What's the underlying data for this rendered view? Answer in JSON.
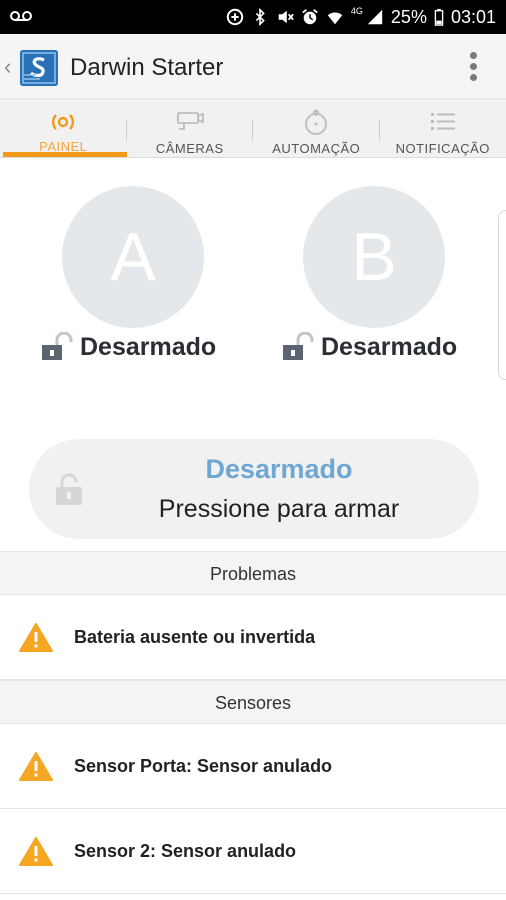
{
  "status_bar": {
    "battery_percent": "25%",
    "time": "03:01",
    "network_tag": "4G",
    "icons": [
      "voicemail-icon",
      "data-saver-icon",
      "bluetooth-icon",
      "mute-icon",
      "alarm-icon",
      "wifi-icon",
      "signal-icon",
      "battery-icon"
    ]
  },
  "app_bar": {
    "title": "Darwin Starter",
    "back_icon": "chevron-left-icon",
    "logo_icon": "darwin-logo-icon",
    "menu_icon": "more-vertical-icon"
  },
  "tabs": [
    {
      "label": "PAINEL",
      "icon": "panel-sensor-icon",
      "active": true
    },
    {
      "label": "CÂMERAS",
      "icon": "camera-icon",
      "active": false
    },
    {
      "label": "AUTOMAÇÃO",
      "icon": "automation-icon",
      "active": false
    },
    {
      "label": "NOTIFICAÇÃO",
      "icon": "list-icon",
      "active": false
    }
  ],
  "partitions": [
    {
      "letter": "A",
      "status": "Desarmado"
    },
    {
      "letter": "B",
      "status": "Desarmado"
    }
  ],
  "arm_button": {
    "status": "Desarmado",
    "hint": "Pressione para armar"
  },
  "problems": {
    "header": "Problemas",
    "items": [
      {
        "text": "Bateria ausente ou invertida"
      }
    ]
  },
  "sensors": {
    "header": "Sensores",
    "items": [
      {
        "text": "Sensor Porta: Sensor anulado"
      },
      {
        "text": "Sensor 2: Sensor anulado"
      }
    ]
  },
  "colors": {
    "accent": "#f29a1c",
    "status_blue": "#6fa7d3",
    "warning": "#f5a623",
    "circle": "#e5e8eb"
  }
}
